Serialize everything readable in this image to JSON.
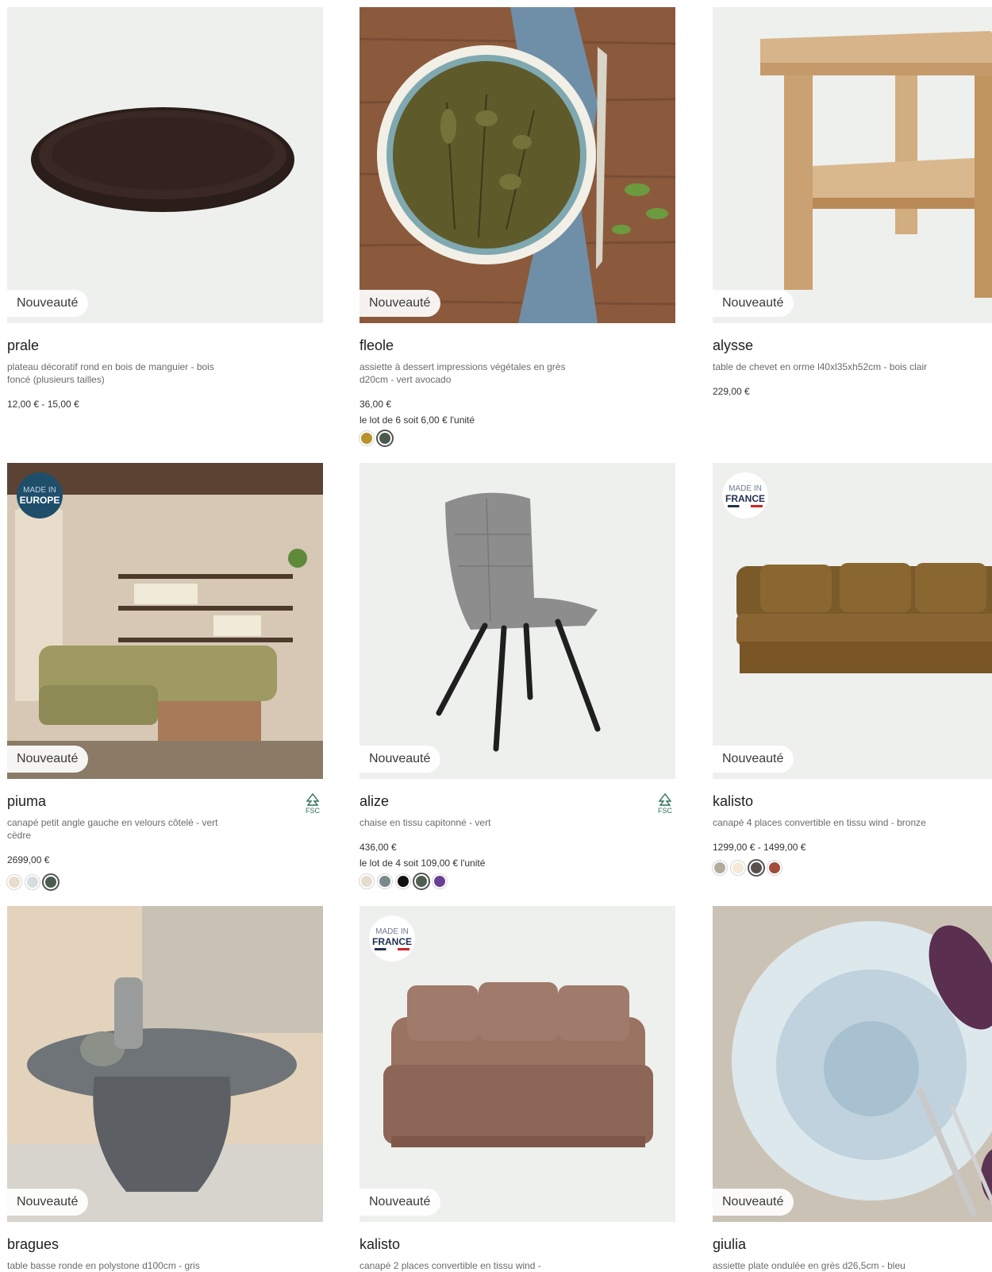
{
  "badge_new": "Nouveauté",
  "made_in_europe": {
    "line1": "MADE IN",
    "line2": "EUROPE"
  },
  "made_in_france": {
    "line1": "MADE IN",
    "line2": "FRANCE"
  },
  "fsc_label": "FSC",
  "products": [
    {
      "name": "prale",
      "desc": "plateau décoratif rond en bois de manguier - bois foncé (plusieurs tailles)",
      "price": "12,00 € - 15,00 €"
    },
    {
      "name": "fleole",
      "desc": "assiette à dessert impressions végétales en grès d20cm - vert avocado",
      "price": "36,00 €",
      "lot": "le lot de 6 soit 6,00 € l'unité",
      "swatches": [
        "#b8922b",
        "#4a5a4a"
      ],
      "selected_swatch": 1
    },
    {
      "name": "alysse",
      "desc": "table de chevet en orme l40xl35xh52cm - bois clair",
      "price": "229,00 €"
    },
    {
      "name": "piuma",
      "desc": "canapé petit angle gauche en velours côtelé - vert cèdre",
      "price": "2699,00 €",
      "swatches": [
        "#e8ddcc",
        "#d8dcdf",
        "#4d5c50"
      ],
      "selected_swatch": 2
    },
    {
      "name": "alize",
      "desc": "chaise en tissu capitonné - vert",
      "price": "436,00 €",
      "lot": "le lot de 4 soit 109,00 € l'unité",
      "swatches": [
        "#e6dccd",
        "#7a8a8a",
        "#111111",
        "#4f6050",
        "#6a3f96"
      ],
      "selected_swatch": 3
    },
    {
      "name": "kalisto",
      "desc": "canapé 4 places convertible en tissu wind - bronze",
      "price": "1299,00 € - 1499,00 €",
      "swatches": [
        "#b3ab9c",
        "#f4ead7",
        "#5a4f4a",
        "#a44c3c"
      ],
      "selected_swatch": 2
    },
    {
      "name": "bragues",
      "desc": "table basse ronde en polystone d100cm - gris"
    },
    {
      "name": "kalisto",
      "desc": "canapé 2 places convertible en tissu wind -"
    },
    {
      "name": "giulia",
      "desc": "assiette plate ondulée en grès d26,5cm - bleu"
    }
  ]
}
